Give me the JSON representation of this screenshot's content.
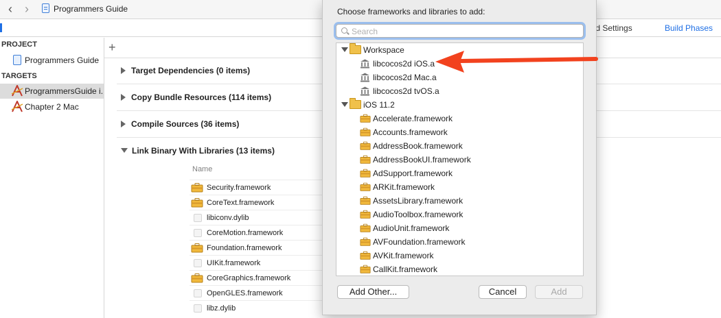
{
  "topbar": {
    "title": "Programmers Guide",
    "back": "‹",
    "forward": "›"
  },
  "tabs": {
    "build_settings": "ild Settings",
    "build_phases": "Build Phases"
  },
  "sidebar": {
    "project_header": "PROJECT",
    "project_item": "Programmers Guide",
    "targets_header": "TARGETS",
    "targets": [
      {
        "label": "ProgrammersGuide i...",
        "selected": true
      },
      {
        "label": "Chapter 2 Mac",
        "selected": false
      }
    ]
  },
  "main": {
    "add_symbol": "+",
    "phases": [
      {
        "label": "Target Dependencies (0 items)",
        "expanded": false
      },
      {
        "label": "Copy Bundle Resources (114 items)",
        "expanded": false
      },
      {
        "label": "Compile Sources (36 items)",
        "expanded": false
      },
      {
        "label": "Link Binary With Libraries (13 items)",
        "expanded": true
      }
    ],
    "column_name": "Name",
    "libraries": [
      {
        "label": "Security.framework",
        "icon": "framework-icon"
      },
      {
        "label": "CoreText.framework",
        "icon": "framework-icon"
      },
      {
        "label": "libiconv.dylib",
        "icon": "dylib-icon"
      },
      {
        "label": "CoreMotion.framework",
        "icon": "dylib-icon"
      },
      {
        "label": "Foundation.framework",
        "icon": "framework-icon"
      },
      {
        "label": "UIKit.framework",
        "icon": "dylib-icon"
      },
      {
        "label": "CoreGraphics.framework",
        "icon": "framework-icon"
      },
      {
        "label": "OpenGLES.framework",
        "icon": "dylib-icon"
      },
      {
        "label": "libz.dylib",
        "icon": "dylib-icon"
      }
    ]
  },
  "dialog": {
    "title": "Choose frameworks and libraries to add:",
    "search_placeholder": "Search",
    "groups": [
      {
        "label": "Workspace",
        "items": [
          "libcocos2d iOS.a",
          "libcocos2d Mac.a",
          "libcocos2d tvOS.a"
        ]
      },
      {
        "label": "iOS 11.2",
        "items": [
          "Accelerate.framework",
          "Accounts.framework",
          "AddressBook.framework",
          "AddressBookUI.framework",
          "AdSupport.framework",
          "ARKit.framework",
          "AssetsLibrary.framework",
          "AudioToolbox.framework",
          "AudioUnit.framework",
          "AVFoundation.framework",
          "AVKit.framework",
          "CallKit.framework"
        ]
      }
    ],
    "buttons": {
      "add_other": "Add Other...",
      "cancel": "Cancel",
      "add": "Add"
    }
  },
  "colors": {
    "accent": "#1f6fe5",
    "annotation_arrow": "#f2421e",
    "folder": "#f0c14b"
  }
}
